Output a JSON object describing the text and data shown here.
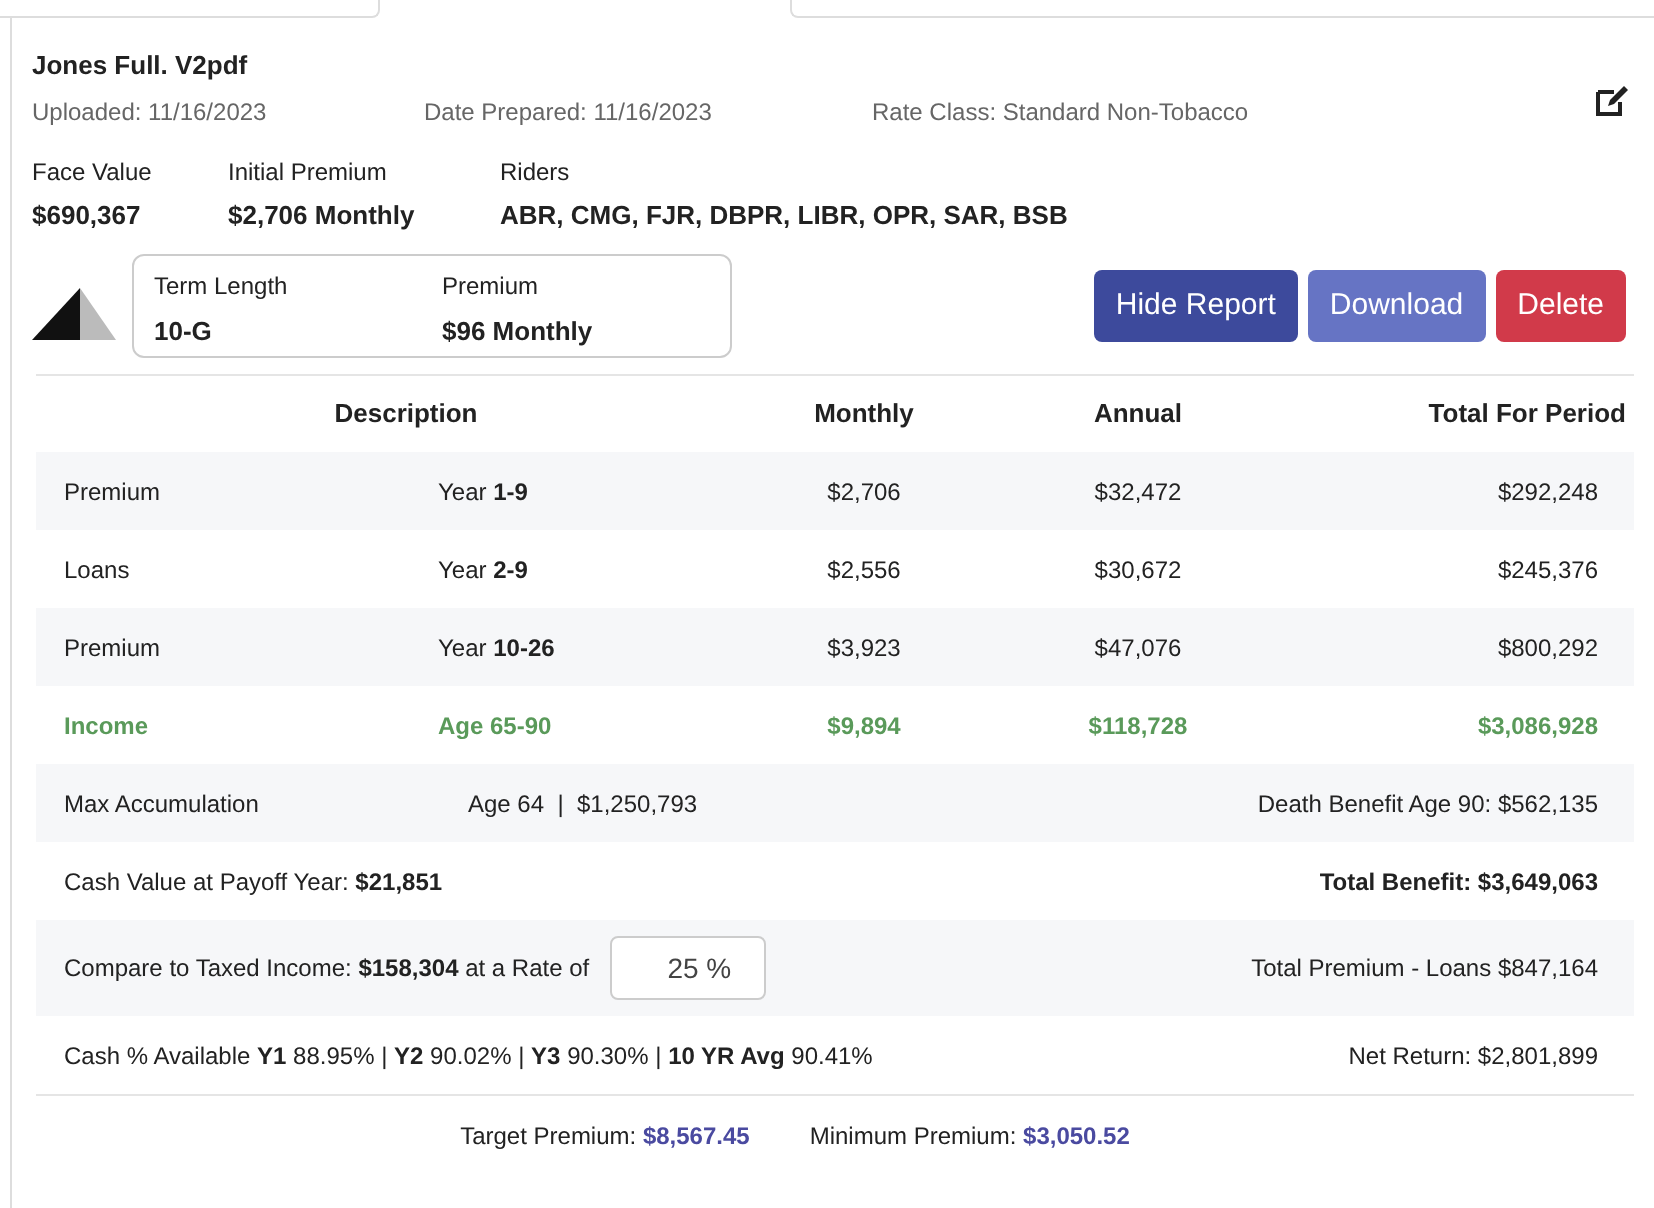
{
  "file": {
    "name": "Jones Full. V2pdf",
    "uploaded": "Uploaded: 11/16/2023",
    "date_prepared": "Date Prepared: 11/16/2023",
    "rate_class": "Rate Class: Standard Non-Tobacco"
  },
  "summary": [
    {
      "label": "Face Value",
      "value": "$690,367"
    },
    {
      "label": "Initial Premium",
      "value": "$2,706 Monthly"
    },
    {
      "label": "Riders",
      "value": "ABR, CMG, FJR, DBPR, LIBR, OPR, SAR, BSB"
    }
  ],
  "term": [
    {
      "label": "Term Length",
      "value": "10-G"
    },
    {
      "label": "Premium",
      "value": "$96 Monthly"
    }
  ],
  "buttons": [
    {
      "label": "Hide Report",
      "kind": "primary"
    },
    {
      "label": "Download",
      "kind": "secondary"
    },
    {
      "label": "Delete",
      "kind": "danger"
    }
  ],
  "table": {
    "columns": [
      "Description",
      "Monthly",
      "Annual",
      "Total For Period"
    ],
    "rows": [
      {
        "description": "Premium",
        "period": "Year **1-9**",
        "monthly": "$2,706",
        "annual": "$32,472",
        "total": "$292,248",
        "highlight": false
      },
      {
        "description": "Loans",
        "period": "Year **2-9**",
        "monthly": "$2,556",
        "annual": "$30,672",
        "total": "$245,376",
        "highlight": false
      },
      {
        "description": "Premium",
        "period": "Year **10-26**",
        "monthly": "$3,923",
        "annual": "$47,076",
        "total": "$800,292",
        "highlight": false
      },
      {
        "description": "Income",
        "period": "Age 65-90",
        "monthly": "$9,894",
        "annual": "$118,728",
        "total": "$3,086,928",
        "highlight": true
      }
    ]
  },
  "details": [
    {
      "kind": "split",
      "left": "Max Accumulation",
      "middle": "Age 64  |  $1,250,793",
      "right": "Death Benefit Age 90: $562,135"
    },
    {
      "kind": "plain",
      "left": "Cash Value at Payoff Year: **$21,851**",
      "right": "**Total Benefit: $3,649,063**"
    },
    {
      "kind": "rate",
      "left": "Compare to Taxed Income: **$158,304** at a Rate of",
      "rate": "25 %",
      "right": "Total Premium - Loans $847,164"
    },
    {
      "kind": "plain",
      "left": "Cash % Available **Y1** 88.95% |  **Y2** 90.02% |  **Y3** 90.30% |  **10 YR Avg** 90.41%",
      "right": "Net Return: $2,801,899"
    }
  ],
  "footer": [
    "Target Premium: **$8,567.45**",
    "Minimum Premium: **$3,050.52**"
  ]
}
